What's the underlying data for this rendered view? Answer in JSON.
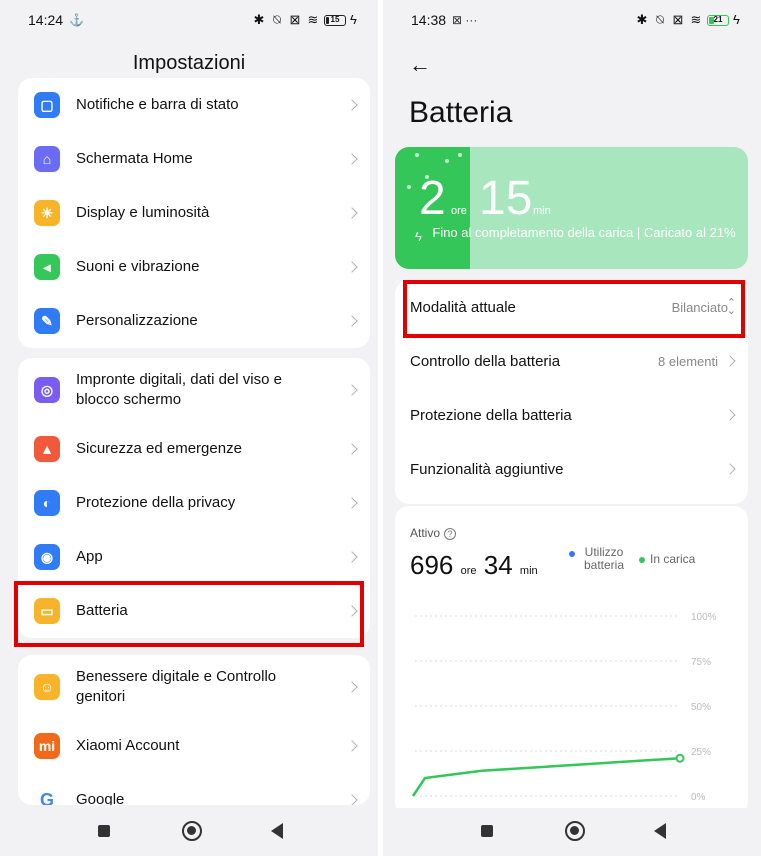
{
  "left": {
    "status": {
      "time": "14:24",
      "extra": "⚓",
      "battery": "15"
    },
    "title": "Impostazioni",
    "groups": [
      [
        {
          "label": "Notifiche e barra di stato",
          "color": "#2f7cf6",
          "glyph": "▢"
        },
        {
          "label": "Schermata Home",
          "color": "#6b6cf5",
          "glyph": "⌂"
        },
        {
          "label": "Display e luminosità",
          "color": "#f7b42a",
          "glyph": "☀"
        },
        {
          "label": "Suoni e vibrazione",
          "color": "#34c759",
          "glyph": "◂"
        },
        {
          "label": "Personalizzazione",
          "color": "#2f7cf6",
          "glyph": "✎"
        }
      ],
      [
        {
          "label": "Impronte digitali, dati del viso e blocco schermo",
          "color": "#7b5cf0",
          "glyph": "◎"
        },
        {
          "label": "Sicurezza ed emergenze",
          "color": "#f05a3a",
          "glyph": "▲"
        },
        {
          "label": "Protezione della privacy",
          "color": "#2f7cf6",
          "glyph": "◐"
        },
        {
          "label": "App",
          "color": "#2f7cf6",
          "glyph": "◉"
        },
        {
          "label": "Batteria",
          "color": "#f7b42a",
          "glyph": "▭"
        }
      ],
      [
        {
          "label": "Benessere digitale e Controllo genitori",
          "color": "#f7b42a",
          "glyph": "☺"
        },
        {
          "label": "Xiaomi Account",
          "color": "#f06a1a",
          "glyph": "mi"
        },
        {
          "label": "Google",
          "color": "#ffffff",
          "glyph": "G"
        }
      ]
    ]
  },
  "right": {
    "status": {
      "time": "14:38",
      "extra": "⊠ ···",
      "battery": "21"
    },
    "title": "Batteria",
    "charge": {
      "hours": "2",
      "hours_unit": "ore",
      "minutes": "15",
      "minutes_unit": "min",
      "text": "Fino al completamento della carica | Caricato al 21%"
    },
    "rows": [
      {
        "label": "Modalità attuale",
        "value": "Bilanciato"
      },
      {
        "label": "Controllo della batteria",
        "value": "8 elementi"
      },
      {
        "label": "Protezione della batteria",
        "value": ""
      },
      {
        "label": "Funzionalità aggiuntive",
        "value": ""
      }
    ],
    "activity": {
      "label": "Attivo",
      "hours": "696",
      "hours_unit": "ore",
      "minutes": "34",
      "minutes_unit": "min",
      "legend_usage": "Utilizzo batteria",
      "legend_charging": "In carica",
      "usage_color": "#3478f6",
      "charging_color": "#34c659"
    },
    "chart_data": {
      "type": "line",
      "y_ticks": [
        "100%",
        "75%",
        "50%",
        "25%",
        "0%"
      ],
      "ylim": [
        0,
        100
      ],
      "series": [
        {
          "name": "In carica",
          "values": [
            0,
            10,
            12,
            14,
            15,
            16,
            17,
            18,
            19,
            20,
            21
          ]
        }
      ]
    }
  }
}
